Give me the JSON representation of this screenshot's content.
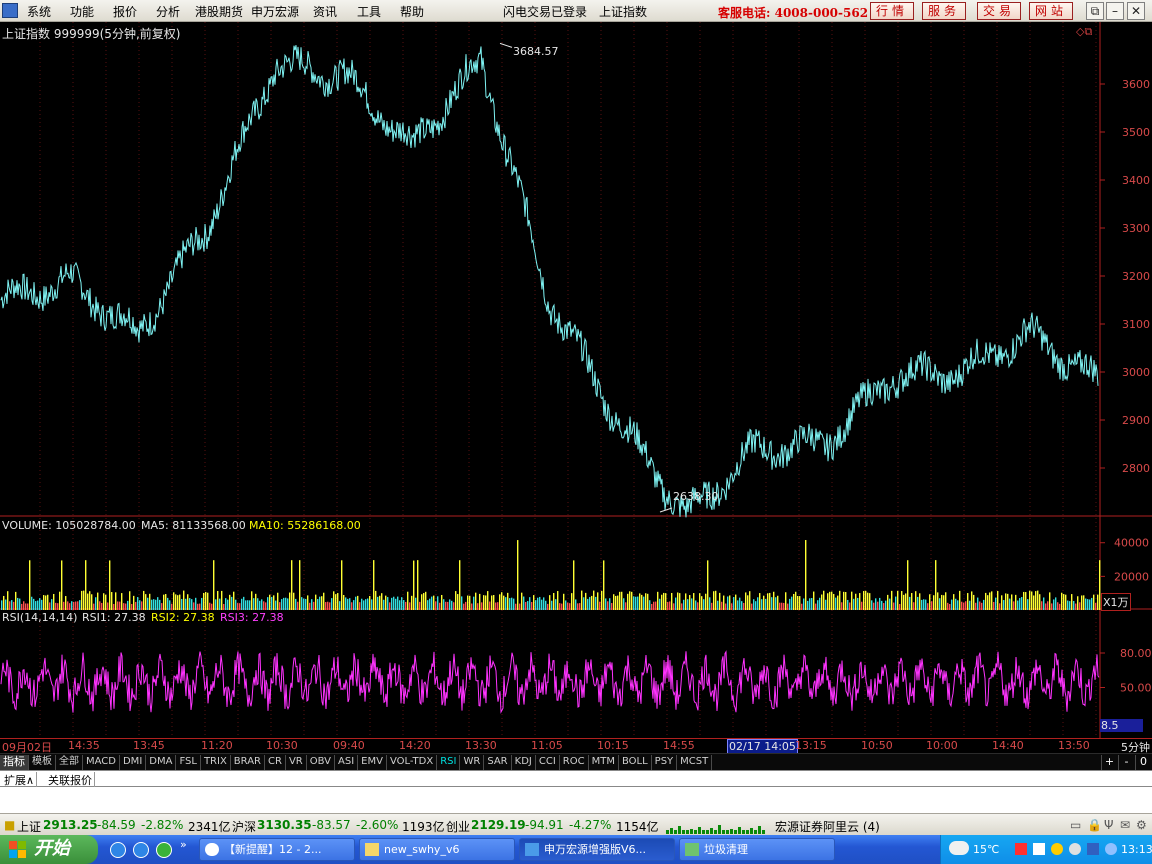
{
  "menu": {
    "items": [
      "系统",
      "功能",
      "报价",
      "分析",
      "港股期货",
      "申万宏源",
      "资讯",
      "工具",
      "帮助"
    ],
    "login_status": "闪电交易已登录",
    "current_index": "上证指数",
    "hotline": "客服电话: 4008-000-562",
    "top_buttons": [
      "行情",
      "服务",
      "交易",
      "网站"
    ]
  },
  "chart": {
    "title": "上证指数 999999(5分钟,前复权)",
    "high_label": "3684.57",
    "low_label": "2638.30",
    "price_axis": [
      "3600",
      "3500",
      "3400",
      "3300",
      "3200",
      "3100",
      "3000",
      "2900",
      "2800"
    ],
    "volume_line": {
      "volume": "VOLUME: 105028784.00",
      "ma5": "MA5: 81133568.00",
      "ma10": "MA10: 55286168.00"
    },
    "volume_axis": [
      "40000",
      "20000"
    ],
    "volume_unit": "X1万",
    "rsi_line": {
      "name": "RSI(14,14,14)",
      "rsi1": "RSI1: 27.38",
      "rsi2": "RSI2: 27.38",
      "rsi3": "RSI3: 27.38"
    },
    "rsi_axis": [
      "80.00",
      "50.00"
    ],
    "rsi_current": "8.5",
    "time_labels": [
      "09月02日",
      "14:35",
      "13:45",
      "11:20",
      "10:30",
      "09:40",
      "14:20",
      "13:30",
      "11:05",
      "10:15",
      "14:55",
      "13:15",
      "10:50",
      "10:00",
      "14:40",
      "13:50"
    ],
    "time_highlight": "02/17 14:05",
    "period": "5分钟"
  },
  "chart_data": {
    "type": "line",
    "title": "上证指数 999999(5分钟,前复权)",
    "x": [
      "09月02日",
      "14:35",
      "13:45",
      "11:20",
      "10:30",
      "09:40",
      "14:20",
      "13:30",
      "11:05",
      "10:15",
      "14:55",
      "02/17 14:05",
      "13:15",
      "10:50",
      "10:00",
      "14:40",
      "13:50"
    ],
    "series": [
      {
        "name": "上证指数",
        "values": [
          3150,
          3190,
          3080,
          3300,
          3640,
          3620,
          3470,
          3650,
          3150,
          2900,
          2700,
          2840,
          2850,
          2990,
          3000,
          3080,
          2980
        ]
      }
    ],
    "annotations": {
      "high": 3684.57,
      "low": 2638.3
    },
    "ylim": [
      2700,
      3700
    ],
    "volume_ylim": [
      0,
      40000
    ],
    "rsi_ylim": [
      20,
      100
    ]
  },
  "tabs": {
    "items": [
      "指标",
      "模板",
      "全部",
      "MACD",
      "DMI",
      "DMA",
      "FSL",
      "TRIX",
      "BRAR",
      "CR",
      "VR",
      "OBV",
      "ASI",
      "EMV",
      "VOL-TDX",
      "RSI",
      "WR",
      "SAR",
      "KDJ",
      "CCI",
      "ROC",
      "MTM",
      "BOLL",
      "PSY",
      "MCST"
    ],
    "active": "RSI",
    "controls": [
      "+",
      "-",
      "0"
    ]
  },
  "expand": {
    "items": [
      "扩展∧",
      "关联报价"
    ]
  },
  "status": {
    "sh_name": "上证",
    "sh_value": "2913.25",
    "sh_change": "-84.59",
    "sh_pct": "-2.82%",
    "sh_amount": "2341亿",
    "hs_name": "沪深",
    "hs_value": "3130.35",
    "hs_change": "-83.57",
    "hs_pct": "-2.60%",
    "hs_amount": "1193亿",
    "cy_name": "创业",
    "cy_value": "2129.19",
    "cy_change": "-94.91",
    "cy_pct": "-4.27%",
    "cy_amount": "1154亿",
    "broker": "宏源证券阿里云 (4)"
  },
  "taskbar": {
    "start": "开始",
    "tasks": [
      "【新提醒】12 - 2...",
      "new_swhy_v6",
      "申万宏源增强版V6...",
      "垃圾清理"
    ],
    "temperature": "15℃",
    "clock": "13:13"
  }
}
